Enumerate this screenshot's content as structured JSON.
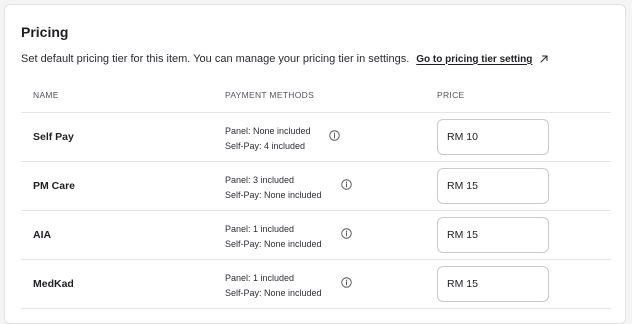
{
  "section": {
    "title": "Pricing",
    "description": "Set default pricing tier for this item. You can manage your pricing tier in settings.",
    "link_label": "Go to pricing tier setting"
  },
  "table": {
    "headers": {
      "name": "NAME",
      "payment_methods": "PAYMENT METHODS",
      "price": "PRICE"
    },
    "rows": [
      {
        "name": "Self Pay",
        "panel": "Panel: None included",
        "self_pay": "Self-Pay: 4 included",
        "price": "RM 10"
      },
      {
        "name": "PM Care",
        "panel": "Panel: 3 included",
        "self_pay": "Self-Pay: None included",
        "price": "RM 15"
      },
      {
        "name": "AIA",
        "panel": "Panel: 1 included",
        "self_pay": "Self-Pay: None included",
        "price": "RM 15"
      },
      {
        "name": "MedKad",
        "panel": "Panel: 1 included",
        "self_pay": "Self-Pay: None included",
        "price": "RM 15"
      }
    ]
  },
  "icons": {
    "link": "external-link-icon",
    "info": "info-icon"
  }
}
